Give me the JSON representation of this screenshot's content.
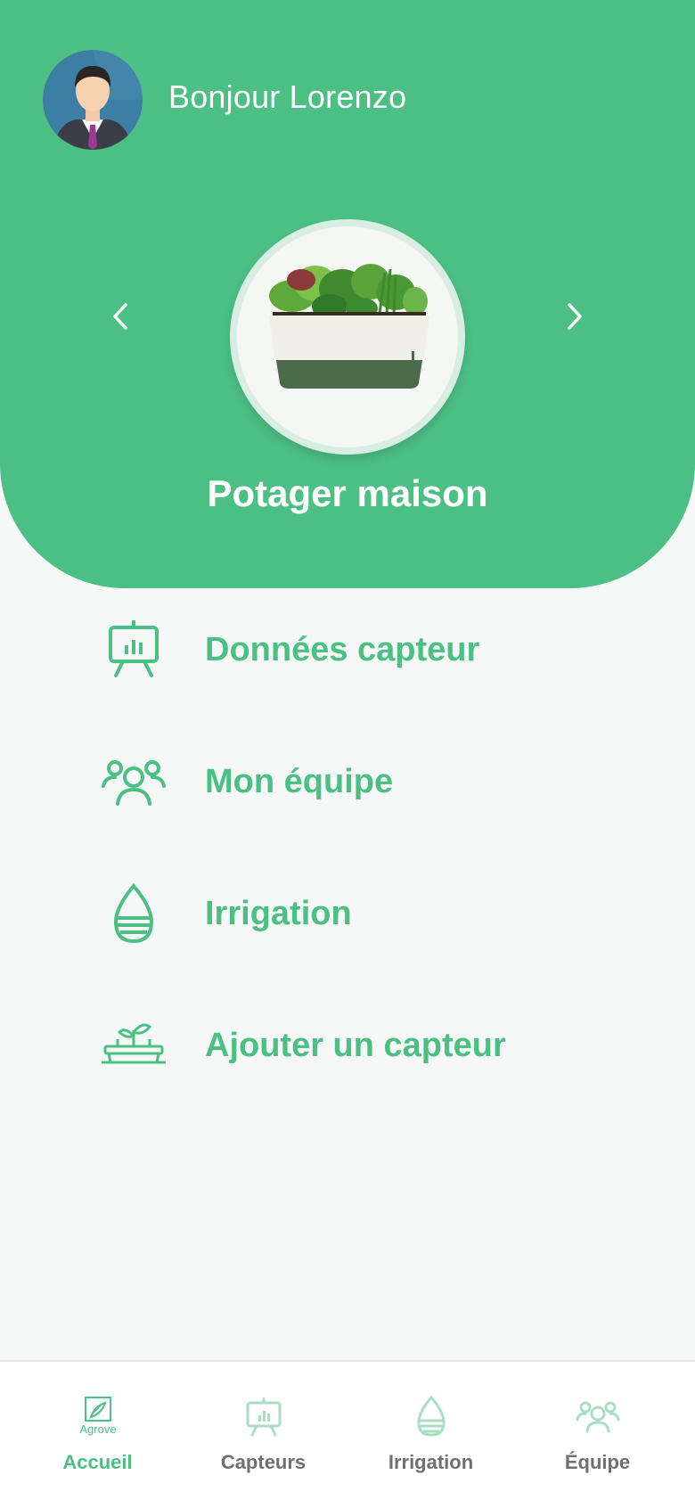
{
  "header": {
    "greeting": "Bonjour Lorenzo",
    "prev_icon": "chevron-left-icon",
    "next_icon": "chevron-right-icon",
    "garden_name": "Potager maison"
  },
  "menu": {
    "items": [
      {
        "label": "Données capteur",
        "icon": "chart-board-icon"
      },
      {
        "label": "Mon équipe",
        "icon": "team-icon"
      },
      {
        "label": "Irrigation",
        "icon": "water-drop-icon"
      },
      {
        "label": "Ajouter un capteur",
        "icon": "planter-sprout-icon"
      }
    ]
  },
  "bottom_nav": {
    "items": [
      {
        "label": "Accueil",
        "icon": "agrove-logo-icon",
        "logo_text": "Agrove",
        "active": true
      },
      {
        "label": "Capteurs",
        "icon": "chart-board-icon",
        "active": false
      },
      {
        "label": "Irrigation",
        "icon": "water-drop-icon",
        "active": false
      },
      {
        "label": "Équipe",
        "icon": "team-icon",
        "active": false
      }
    ]
  },
  "colors": {
    "brand_green": "#4cbf84",
    "background": "#f6f8f7",
    "inactive_nav": "#6f6f6f"
  }
}
